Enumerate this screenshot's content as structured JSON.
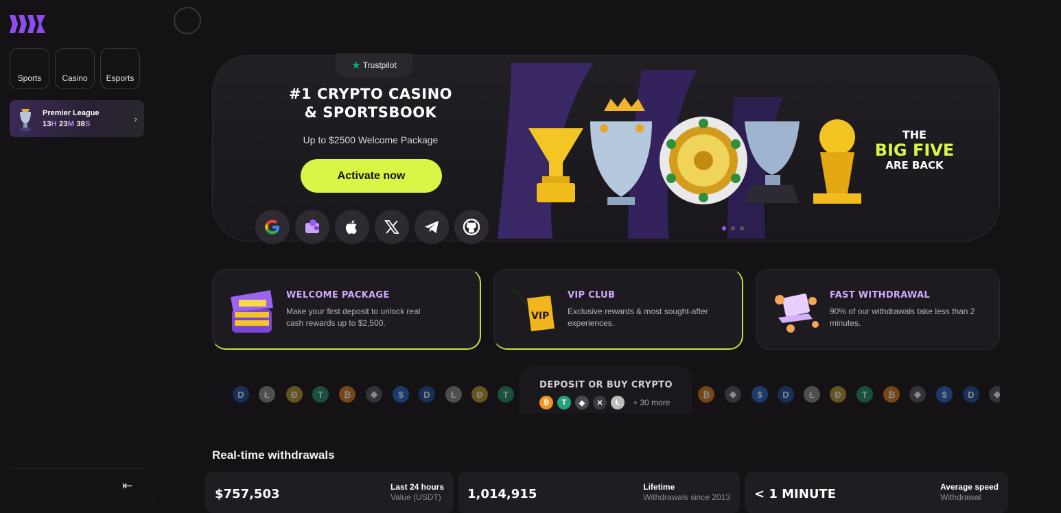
{
  "sidebar": {
    "nav": [
      {
        "label": "Sports",
        "icon": "football-icon"
      },
      {
        "label": "Casino",
        "icon": "cards-icon"
      },
      {
        "label": "Esports",
        "icon": "controller-icon"
      }
    ],
    "promo": {
      "title": "Premier League",
      "timer": {
        "h": "13",
        "h_unit": "H",
        "m": "23",
        "m_unit": "M",
        "s": "38",
        "s_unit": "S"
      },
      "arrow": "›"
    },
    "collapse_icon": "⇤"
  },
  "hero": {
    "trustpilot": "Trustpilot",
    "title_line1": "#1 CRYPTO CASINO",
    "title_line2": "& SPORTSBOOK",
    "subtitle": "Up to $2500 Welcome Package",
    "cta": "Activate now",
    "social": [
      "google-icon",
      "wallet-icon",
      "apple-icon",
      "x-icon",
      "telegram-icon",
      "github-icon"
    ],
    "banner": {
      "line1": "THE",
      "line2": "BIG FIVE",
      "line3": "ARE BACK"
    },
    "slides": 3,
    "active_slide": 1
  },
  "features": [
    {
      "title": "WELCOME PACKAGE",
      "desc": "Make your first deposit to unlock real cash rewards up to $2,500."
    },
    {
      "title": "VIP CLUB",
      "desc": "Exclusive rewards & most sought-after experiences."
    },
    {
      "title": "FAST WITHDRAWAL",
      "desc": "90% of our withdrawals take less than 2 minutes."
    }
  ],
  "crypto": {
    "title": "DEPOSIT OR BUY CRYPTO",
    "more": "+ 30 more",
    "coins": [
      {
        "symbol": "₿",
        "color": "#f7931a"
      },
      {
        "symbol": "T",
        "color": "#26a17b"
      },
      {
        "symbol": "◆",
        "color": "#4a4a52"
      },
      {
        "symbol": "✕",
        "color": "#3a3a40"
      },
      {
        "symbol": "Ł",
        "color": "#bfbbbb"
      }
    ]
  },
  "withdrawals": {
    "title": "Real-time withdrawals",
    "stats": [
      {
        "value": "$757,503",
        "label": "Last 24 hours",
        "sub": "Value (USDT)"
      },
      {
        "value": "1,014,915",
        "label": "Lifetime",
        "sub": "Withdrawals since 2013"
      },
      {
        "value": "< 1 MINUTE",
        "label": "Average speed",
        "sub": "Withdrawal"
      }
    ]
  },
  "colors": {
    "accent": "#d9f545",
    "purple": "#9b5cff",
    "background": "#141214"
  }
}
